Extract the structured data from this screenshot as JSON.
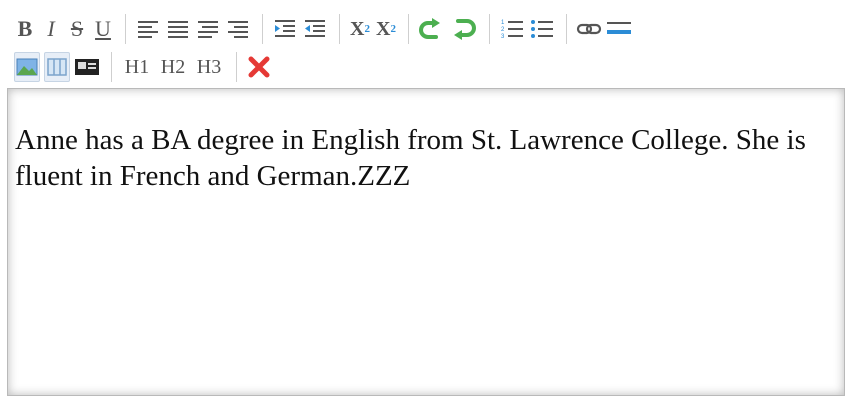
{
  "toolbar": {
    "row1": {
      "bold": "B",
      "italic": "I",
      "strikethrough": "S",
      "underline": "U",
      "subscript": "X",
      "subscript_mark": "2",
      "superscript": "X",
      "superscript_mark": "2"
    },
    "row2": {
      "h1": "H1",
      "h2": "H2",
      "h3": "H3"
    },
    "icons": [
      "align-left-icon",
      "align-center-icon",
      "align-right-icon",
      "align-justify-icon",
      "indent-icon",
      "outdent-icon",
      "redo-icon",
      "undo-icon",
      "ordered-list-icon",
      "unordered-list-icon",
      "link-icon",
      "horizontal-rule-icon",
      "insert-image-icon",
      "table-icon",
      "media-icon",
      "close-icon"
    ],
    "colors": {
      "icon_gray": "#555555",
      "green": "#4caf50",
      "red": "#e53935",
      "blue": "#2b8cd6"
    }
  },
  "editor": {
    "content": "Anne has a BA degree in English from St. Lawrence College. She is fluent in French and German.ZZZ"
  }
}
